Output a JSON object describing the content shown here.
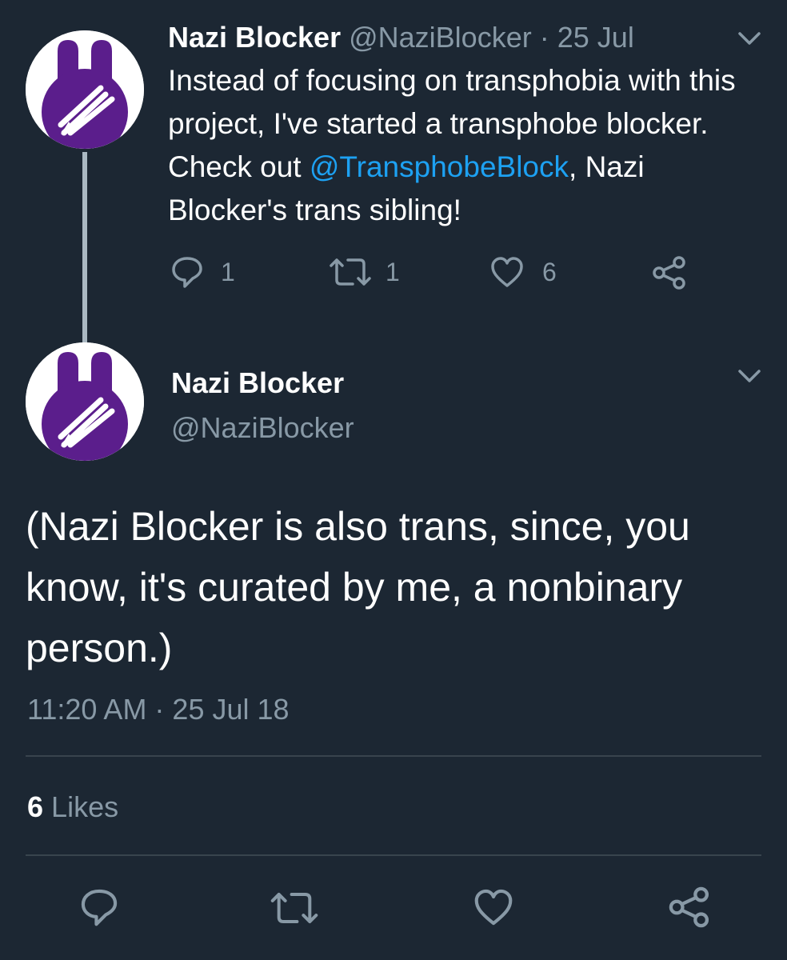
{
  "parent_tweet": {
    "display_name": "Nazi Blocker",
    "handle": "@NaziBlocker",
    "separator": "·",
    "date": "25 Jul",
    "text_before": "Instead of focusing on transphobia with this project, I've started a transphobe blocker. Check out ",
    "mention": "@TransphobeBlock",
    "text_after": ", Nazi Blocker's trans sibling!",
    "reply_count": "1",
    "retweet_count": "1",
    "like_count": "6"
  },
  "main_tweet": {
    "display_name": "Nazi Blocker",
    "handle": "@NaziBlocker",
    "text": "(Nazi Blocker is also trans, since, you know, it's curated by me, a nonbinary person.)",
    "timestamp": "11:20 AM · 25 Jul 18",
    "likes_count": "6",
    "likes_label": "Likes"
  },
  "icons": {
    "reply": "reply-icon",
    "retweet": "retweet-icon",
    "like": "heart-icon",
    "share": "share-icon",
    "more": "chevron-down-icon"
  },
  "colors": {
    "background": "#1c2733",
    "text": "#ffffff",
    "muted": "#8899a6",
    "link": "#1da1f2",
    "avatar_purple": "#5b1e8c",
    "divider": "#38444d"
  }
}
